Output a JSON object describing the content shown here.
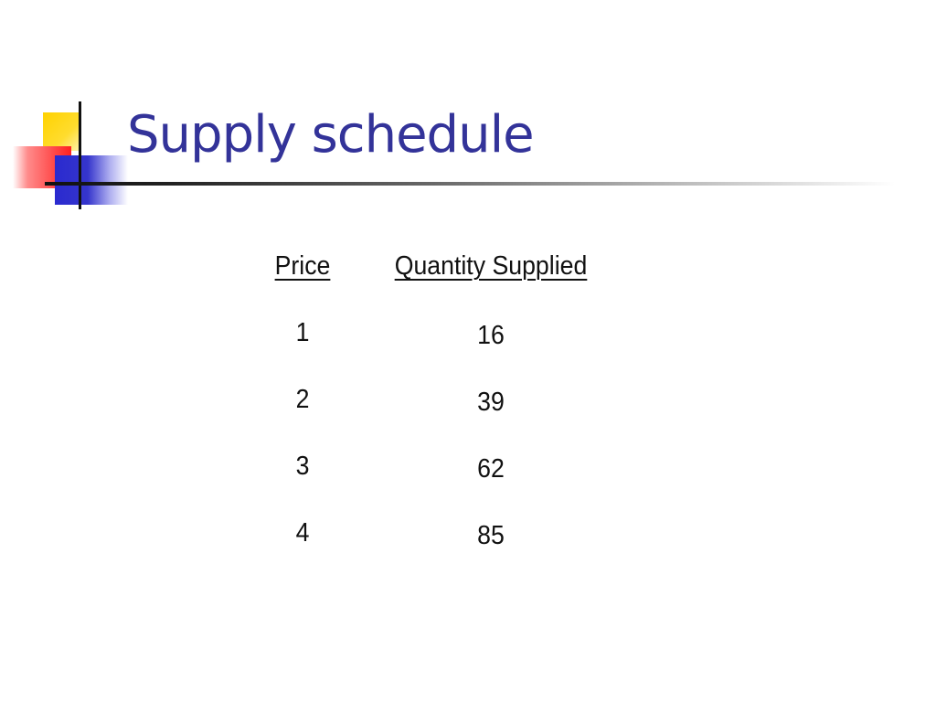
{
  "slide": {
    "title": "Supply schedule",
    "title_color": "#333399"
  },
  "table": {
    "headers": {
      "price": "Price",
      "quantity": "Quantity Supplied"
    },
    "rows": [
      {
        "price": "1",
        "quantity": "16"
      },
      {
        "price": "2",
        "quantity": "39"
      },
      {
        "price": "3",
        "quantity": "62"
      },
      {
        "price": "4",
        "quantity": "85"
      }
    ]
  }
}
